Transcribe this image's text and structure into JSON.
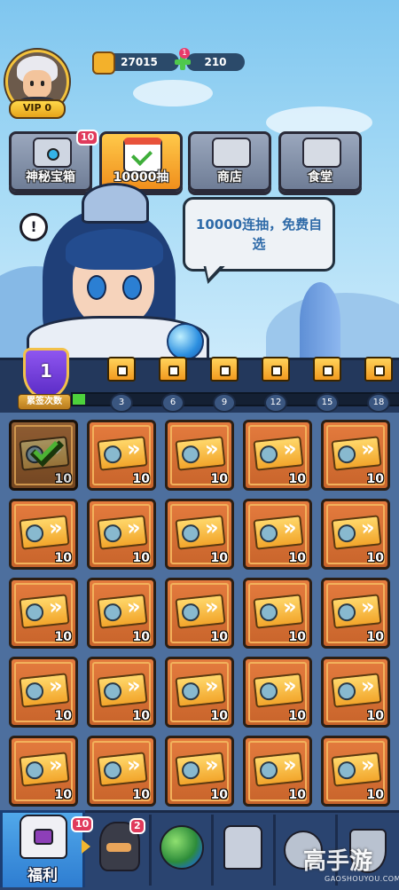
{
  "profile": {
    "vip_label": "VIP 0"
  },
  "currencies": {
    "power": "27015",
    "gems": "210",
    "gems_badge": "1"
  },
  "features": [
    {
      "label": "神秘宝箱",
      "badge": "10"
    },
    {
      "label": "10000抽",
      "badge": ""
    },
    {
      "label": "商店",
      "badge": ""
    },
    {
      "label": "食堂",
      "badge": ""
    }
  ],
  "banner": {
    "speech": "10000连抽，免费自选",
    "alert": "!"
  },
  "progress": {
    "level": "1",
    "label": "累签次数",
    "fill_fraction": 0.01,
    "milestones": [
      "3",
      "6",
      "9",
      "12",
      "15",
      "18"
    ]
  },
  "rewards": {
    "quantity": "10",
    "rows": [
      [
        {
          "claimed": true
        },
        {
          "claimed": false
        },
        {
          "claimed": false
        },
        {
          "claimed": false
        },
        {
          "claimed": false
        }
      ],
      [
        {
          "claimed": false
        },
        {
          "claimed": false
        },
        {
          "claimed": false
        },
        {
          "claimed": false
        },
        {
          "claimed": false
        }
      ],
      [
        {
          "claimed": false
        },
        {
          "claimed": false
        },
        {
          "claimed": false
        },
        {
          "claimed": false
        },
        {
          "claimed": false
        }
      ],
      [
        {
          "claimed": false
        },
        {
          "claimed": false
        },
        {
          "claimed": false
        },
        {
          "claimed": false
        },
        {
          "claimed": false
        }
      ],
      [
        {
          "claimed": false
        },
        {
          "claimed": false
        },
        {
          "claimed": false
        },
        {
          "claimed": false
        },
        {
          "claimed": false
        }
      ]
    ]
  },
  "nav": {
    "active_label": "福利",
    "active_badge": "10",
    "hero_badge": "2",
    "icons": [
      "gift-chest-icon",
      "hero-icon",
      "world-globe-icon",
      "building-icon",
      "map-pin-icon",
      "shield-icon"
    ]
  },
  "watermark": {
    "brand": "高手游",
    "url": "GAOSHOUYOU.COM"
  }
}
